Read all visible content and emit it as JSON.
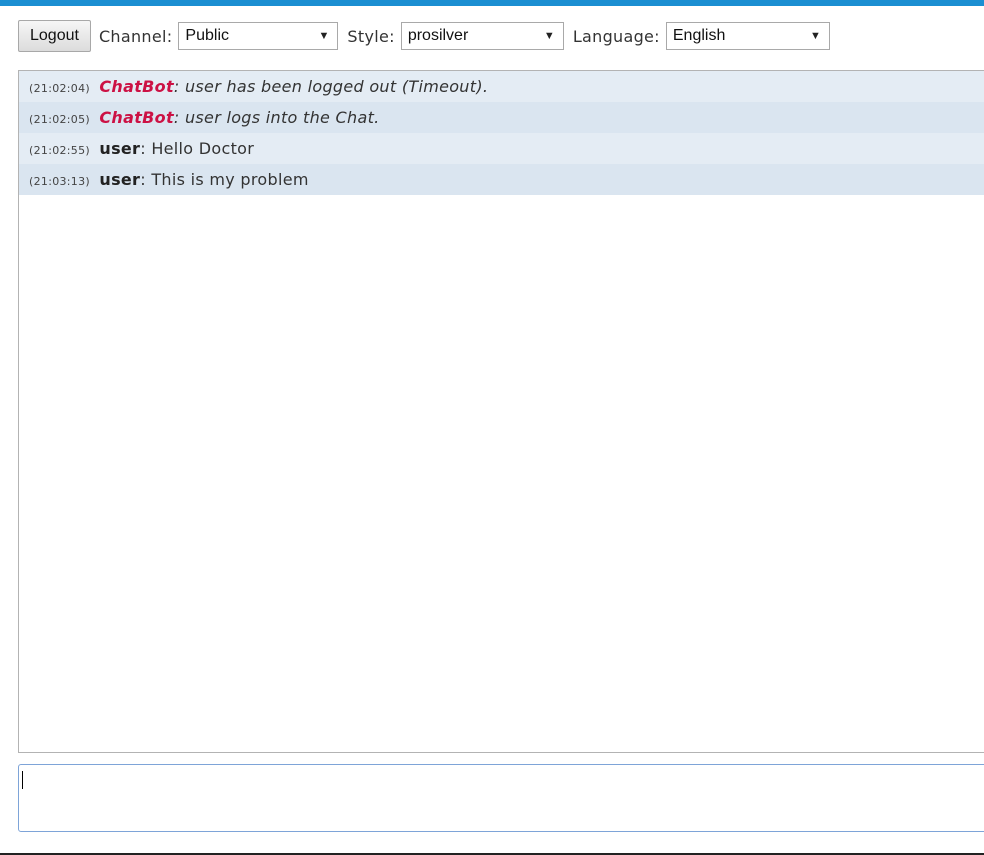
{
  "toolbar": {
    "logout_label": "Logout",
    "channel_label": "Channel:",
    "channel_value": "Public",
    "style_label": "Style:",
    "style_value": "prosilver",
    "language_label": "Language:",
    "language_value": "English"
  },
  "messages": [
    {
      "time": "(21:02:04)",
      "author": "ChatBot",
      "text": "user has been logged out (Timeout)."
    },
    {
      "time": "(21:02:05)",
      "author": "ChatBot",
      "text": "user logs into the Chat."
    },
    {
      "time": "(21:02:55)",
      "author": "user",
      "text": "Hello Doctor"
    },
    {
      "time": "(21:03:13)",
      "author": "user",
      "text": "This is my problem"
    }
  ],
  "input": {
    "value": ""
  },
  "colors": {
    "accent": "#1b8fd2",
    "bot_name": "#cc1144",
    "row_odd": "#e4ecf4",
    "row_even": "#dae5f0"
  }
}
